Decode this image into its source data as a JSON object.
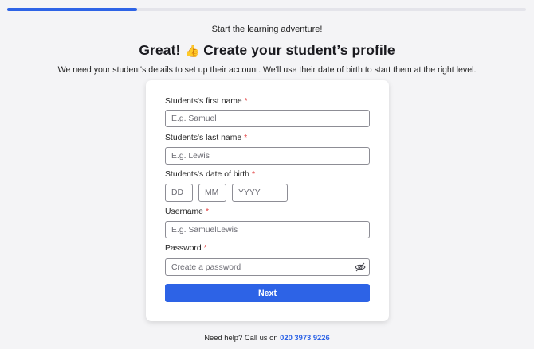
{
  "progress": {
    "fraction": 0.25,
    "color": "#2d63e6"
  },
  "header": {
    "subtitle": "Start the learning adventure!",
    "title_before": "Great!",
    "title_emoji": "👍",
    "title_after": "Create your student’s profile",
    "description": "We need your student's details to set up their account. We'll use their date of birth to start them at the right level."
  },
  "form": {
    "first_name": {
      "label": "Students's first name",
      "required_mark": "*",
      "placeholder": "E.g. Samuel",
      "value": ""
    },
    "last_name": {
      "label": "Students's last name",
      "required_mark": "*",
      "placeholder": "E.g. Lewis",
      "value": ""
    },
    "dob": {
      "label": "Students's date of birth",
      "required_mark": "*",
      "day_placeholder": "DD",
      "month_placeholder": "MM",
      "year_placeholder": "YYYY"
    },
    "username": {
      "label": "Username",
      "required_mark": "*",
      "placeholder": "E.g. SamuelLewis",
      "value": ""
    },
    "password": {
      "label": "Password",
      "required_mark": "*",
      "placeholder": "Create a password",
      "toggle_icon": "eye-slash-icon"
    },
    "next_label": "Next"
  },
  "footer": {
    "help_text": "Need help? Call us on",
    "phone": "020 3973 9226"
  }
}
